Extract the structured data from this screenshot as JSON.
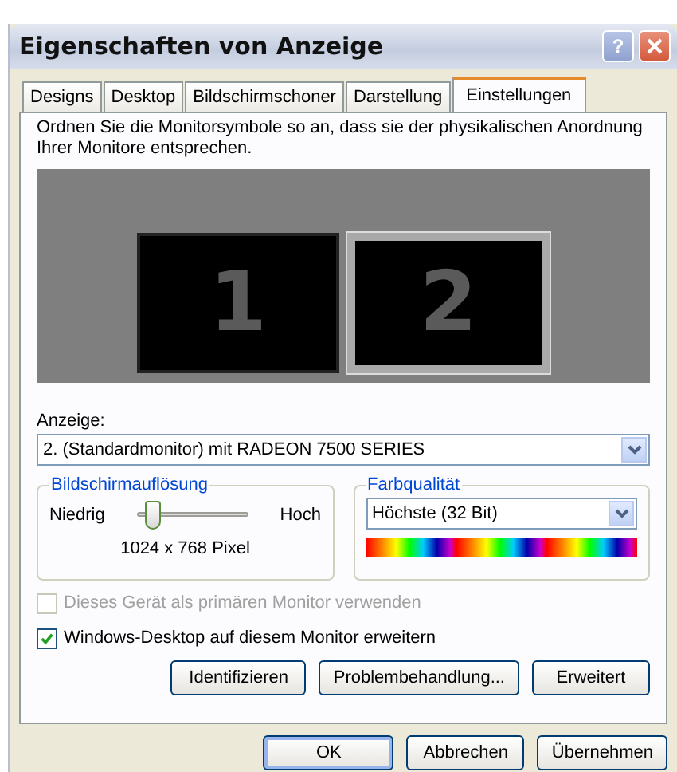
{
  "window": {
    "title": "Eigenschaften von Anzeige",
    "help_button": "?"
  },
  "tabs": [
    {
      "label": "Designs",
      "selected": false
    },
    {
      "label": "Desktop",
      "selected": false
    },
    {
      "label": "Bildschirmschoner",
      "selected": false
    },
    {
      "label": "Darstellung",
      "selected": false
    },
    {
      "label": "Einstellungen",
      "selected": true
    }
  ],
  "instructions": "Ordnen Sie die Monitorsymbole so an, dass sie der physikalischen Anordnung Ihrer Monitore entsprechen.",
  "monitors": [
    {
      "label": "1",
      "selected": false
    },
    {
      "label": "2",
      "selected": true
    }
  ],
  "display": {
    "label": "Anzeige:",
    "value": "2. (Standardmonitor) mit RADEON 7500 SERIES"
  },
  "resolution": {
    "title": "Bildschirmauflösung",
    "low": "Niedrig",
    "high": "Hoch",
    "level": 0.15,
    "reading": "1024 x 768 Pixel"
  },
  "color_quality": {
    "title": "Farbqualität",
    "value": "Höchste (32 Bit)"
  },
  "checkboxes": [
    {
      "label": "Dieses Gerät als primären Monitor verwenden",
      "checked": false,
      "disabled": true
    },
    {
      "label": "Windows-Desktop auf diesem Monitor erweitern",
      "checked": true,
      "disabled": false
    }
  ],
  "panel_buttons": [
    "Identifizieren",
    "Problembehandlung...",
    "Erweitert"
  ],
  "dialog_buttons": [
    {
      "label": "OK",
      "default": true
    },
    {
      "label": "Abbrechen",
      "default": false
    },
    {
      "label": "Übernehmen",
      "default": false
    }
  ]
}
